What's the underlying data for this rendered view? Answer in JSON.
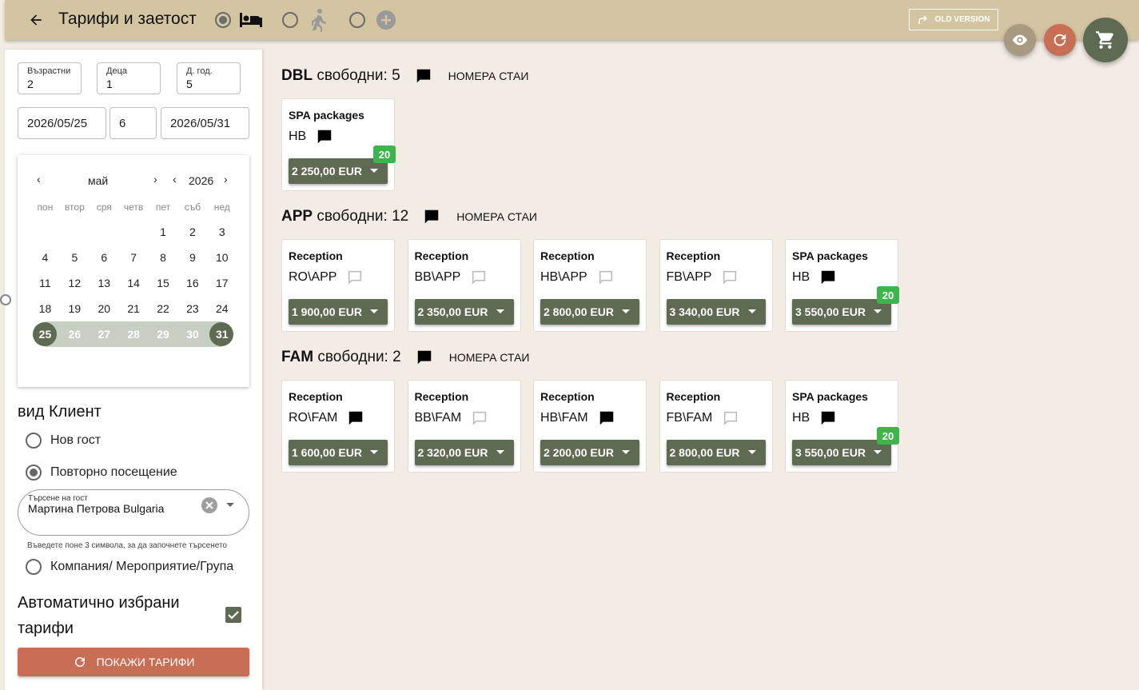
{
  "header": {
    "title": "Тарифи и заетост",
    "old_version_label": "OLD VERSION",
    "modes": [
      {
        "icon": "bed-icon",
        "selected": true
      },
      {
        "icon": "walk-icon",
        "selected": false
      },
      {
        "icon": "add-circle-icon",
        "selected": false
      }
    ]
  },
  "sidebar": {
    "adults": {
      "label": "Възрастни",
      "value": "2"
    },
    "children": {
      "label": "Деца",
      "value": "1"
    },
    "child_age": {
      "label": "Д. год.",
      "value": "5"
    },
    "date_from": "2026/05/25",
    "nights": "6",
    "date_to": "2026/05/31",
    "calendar": {
      "month": "май",
      "year": "2026",
      "weekdays": [
        "пон",
        "втор",
        "сря",
        "четв",
        "пет",
        "съб",
        "нед"
      ],
      "leading_blank_days": 4,
      "days_in_month": 31,
      "range_start": 25,
      "range_end": 31
    },
    "client_type_title": "вид Клиент",
    "client_options": [
      {
        "label": "Нов гост",
        "selected": false
      },
      {
        "label": "Повторно посещение",
        "selected": true
      }
    ],
    "guest_search": {
      "label": "Търсене на гост",
      "value": "Мартина Петрова Bulgaria"
    },
    "search_hint": "Въведете поне 3 символа, за да започнете търсенето",
    "company_option": {
      "label": "Компания/ Мероприятие/Група",
      "selected": false
    },
    "auto_rates_label": "Автоматично избрани тарифи",
    "auto_rates_checked": true,
    "show_rates_button": "ПОКАЖИ ТАРИФИ"
  },
  "room_numbers_label": "НОМЕРА СТАИ",
  "rooms": [
    {
      "code": "DBL",
      "free_label": "свободни:",
      "free_count": "5",
      "comment_filled": true,
      "rates": [
        {
          "name": "SPA packages",
          "board": "HB",
          "comment_filled": true,
          "price": "2 250,00 EUR",
          "discount": "20"
        }
      ]
    },
    {
      "code": "APP",
      "free_label": "свободни:",
      "free_count": "12",
      "comment_filled": true,
      "rates": [
        {
          "name": "Reception",
          "board": "RO\\APP",
          "comment_filled": false,
          "price": "1 900,00 EUR",
          "discount": ""
        },
        {
          "name": "Reception",
          "board": "BB\\APP",
          "comment_filled": false,
          "price": "2 350,00 EUR",
          "discount": ""
        },
        {
          "name": "Reception",
          "board": "HB\\APP",
          "comment_filled": false,
          "price": "2 800,00 EUR",
          "discount": ""
        },
        {
          "name": "Reception",
          "board": "FB\\APP",
          "comment_filled": false,
          "price": "3 340,00 EUR",
          "discount": ""
        },
        {
          "name": "SPA packages",
          "board": "HB",
          "comment_filled": true,
          "price": "3 550,00 EUR",
          "discount": "20"
        }
      ]
    },
    {
      "code": "FAM",
      "free_label": "свободни:",
      "free_count": "2",
      "comment_filled": true,
      "rates": [
        {
          "name": "Reception",
          "board": "RO\\FAM",
          "comment_filled": true,
          "price": "1 600,00 EUR",
          "discount": ""
        },
        {
          "name": "Reception",
          "board": "BB\\FAM",
          "comment_filled": false,
          "price": "2 320,00 EUR",
          "discount": ""
        },
        {
          "name": "Reception",
          "board": "HB\\FAM",
          "comment_filled": true,
          "price": "2 200,00 EUR",
          "discount": ""
        },
        {
          "name": "Reception",
          "board": "FB\\FAM",
          "comment_filled": false,
          "price": "2 800,00 EUR",
          "discount": ""
        },
        {
          "name": "SPA packages",
          "board": "HB",
          "comment_filled": true,
          "price": "3 550,00 EUR",
          "discount": "20"
        }
      ]
    }
  ],
  "colors": {
    "header_bg": "#d3c4a2",
    "page_bg": "#f3ece4",
    "accent_green": "#5e6b52",
    "accent_red": "#c86e55",
    "badge_green": "#3cb54a"
  }
}
